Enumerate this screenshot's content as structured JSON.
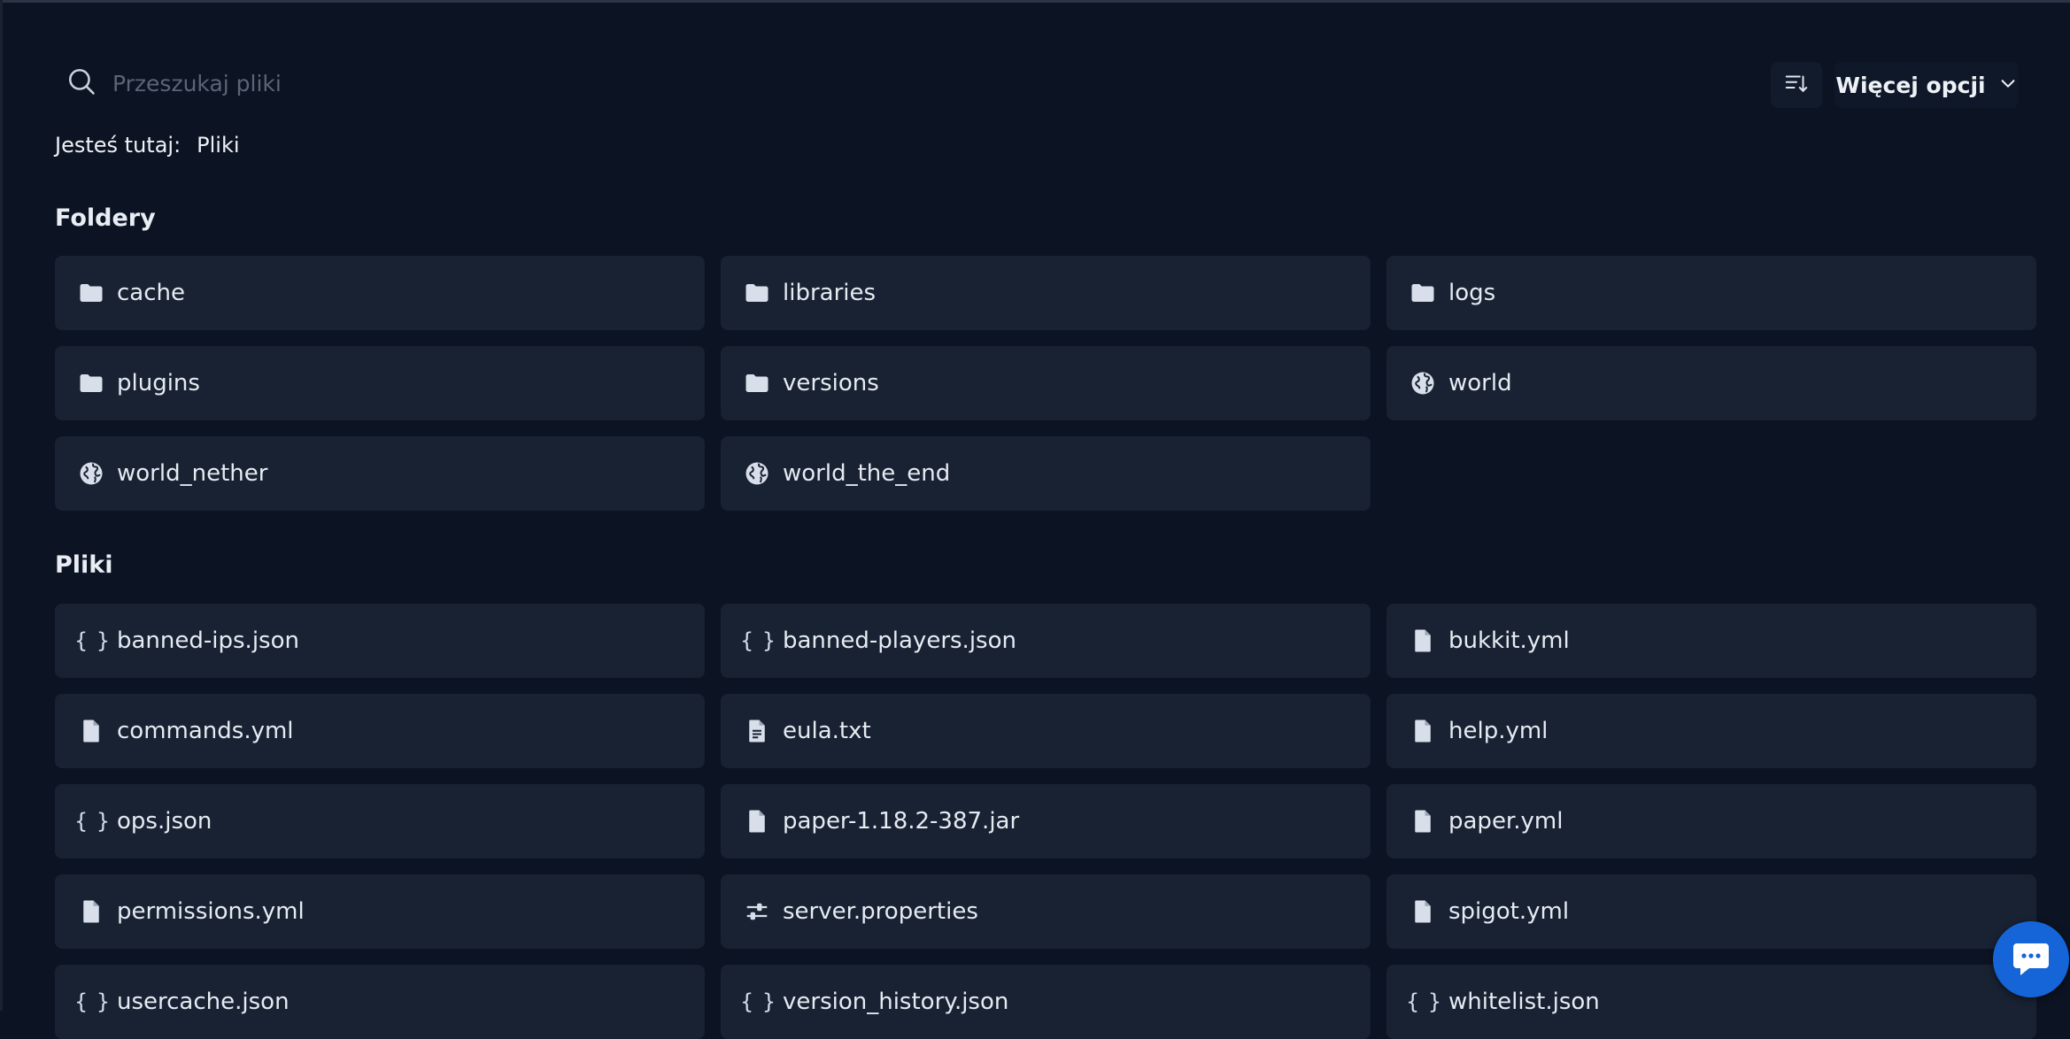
{
  "search": {
    "placeholder": "Przeszukaj pliki"
  },
  "toolbar": {
    "sort_icon": "sort-icon",
    "more_label": "Więcej opcji"
  },
  "breadcrumb": {
    "prefix": "Jesteś tutaj:",
    "current": "Pliki"
  },
  "folders": {
    "title": "Foldery",
    "items": [
      {
        "name": "cache",
        "icon": "folder-icon"
      },
      {
        "name": "libraries",
        "icon": "folder-icon"
      },
      {
        "name": "logs",
        "icon": "folder-icon"
      },
      {
        "name": "plugins",
        "icon": "folder-icon"
      },
      {
        "name": "versions",
        "icon": "folder-icon"
      },
      {
        "name": "world",
        "icon": "globe-icon"
      },
      {
        "name": "world_nether",
        "icon": "globe-icon"
      },
      {
        "name": "world_the_end",
        "icon": "globe-icon"
      }
    ]
  },
  "files": {
    "title": "Pliki",
    "items": [
      {
        "name": "banned-ips.json",
        "icon": "braces-icon"
      },
      {
        "name": "banned-players.json",
        "icon": "braces-icon"
      },
      {
        "name": "bukkit.yml",
        "icon": "file-icon"
      },
      {
        "name": "commands.yml",
        "icon": "file-icon"
      },
      {
        "name": "eula.txt",
        "icon": "text-file-icon"
      },
      {
        "name": "help.yml",
        "icon": "file-icon"
      },
      {
        "name": "ops.json",
        "icon": "braces-icon"
      },
      {
        "name": "paper-1.18.2-387.jar",
        "icon": "file-icon"
      },
      {
        "name": "paper.yml",
        "icon": "file-icon"
      },
      {
        "name": "permissions.yml",
        "icon": "file-icon"
      },
      {
        "name": "server.properties",
        "icon": "sliders-icon"
      },
      {
        "name": "spigot.yml",
        "icon": "file-icon"
      },
      {
        "name": "usercache.json",
        "icon": "braces-icon"
      },
      {
        "name": "version_history.json",
        "icon": "braces-icon"
      },
      {
        "name": "whitelist.json",
        "icon": "braces-icon"
      }
    ]
  },
  "chat": {
    "icon": "chat-icon"
  },
  "colors": {
    "background": "#0c1322",
    "card": "#182233",
    "accent": "#1565d8"
  }
}
